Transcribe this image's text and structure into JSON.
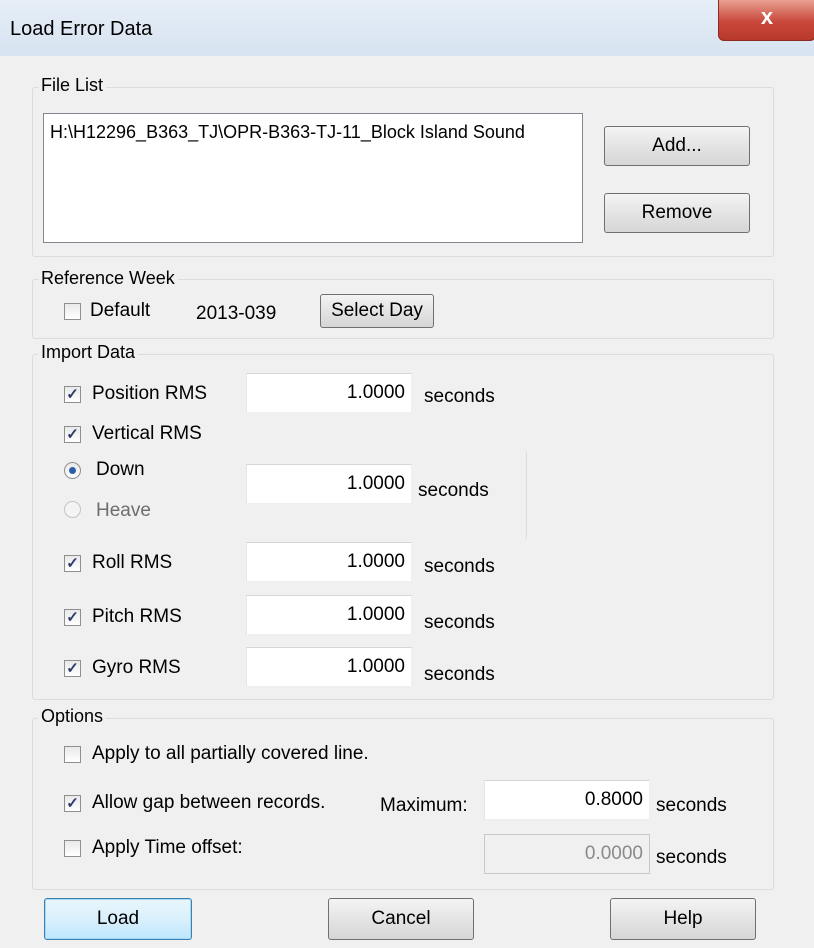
{
  "window": {
    "title": "Load Error Data",
    "close_glyph": "x"
  },
  "file_list": {
    "legend": "File List",
    "items": [
      "H:\\H12296_B363_TJ\\OPR-B363-TJ-11_Block Island Sound"
    ],
    "add_label": "Add...",
    "remove_label": "Remove"
  },
  "reference_week": {
    "legend": "Reference Week",
    "default_label": "Default",
    "default_checked": false,
    "value": "2013-039",
    "select_day_label": "Select Day"
  },
  "import_data": {
    "legend": "Import Data",
    "position_rms": {
      "label": "Position RMS",
      "checked": true,
      "value": "1.0000",
      "unit": "seconds"
    },
    "vertical_rms": {
      "label": "Vertical RMS",
      "checked": true
    },
    "down": {
      "label": "Down",
      "selected": true,
      "value": "1.0000",
      "unit": "seconds"
    },
    "heave": {
      "label": "Heave",
      "selected": false
    },
    "roll_rms": {
      "label": "Roll RMS",
      "checked": true,
      "value": "1.0000",
      "unit": "seconds"
    },
    "pitch_rms": {
      "label": "Pitch RMS",
      "checked": true,
      "value": "1.0000",
      "unit": "seconds"
    },
    "gyro_rms": {
      "label": "Gyro RMS",
      "checked": true,
      "value": "1.0000",
      "unit": "seconds"
    }
  },
  "options": {
    "legend": "Options",
    "apply_partial": {
      "label": "Apply to all partially covered line.",
      "checked": false
    },
    "allow_gap": {
      "label": "Allow gap between records.",
      "checked": true,
      "max_label": "Maximum:",
      "value": "0.8000",
      "unit": "seconds"
    },
    "time_offset": {
      "label": "Apply Time offset:",
      "checked": false,
      "value": "0.0000",
      "unit": "seconds"
    }
  },
  "buttons": {
    "load": "Load",
    "cancel": "Cancel",
    "help": "Help"
  },
  "colors": {
    "accent": "#3c7fb1",
    "close_red": "#c9473a"
  }
}
